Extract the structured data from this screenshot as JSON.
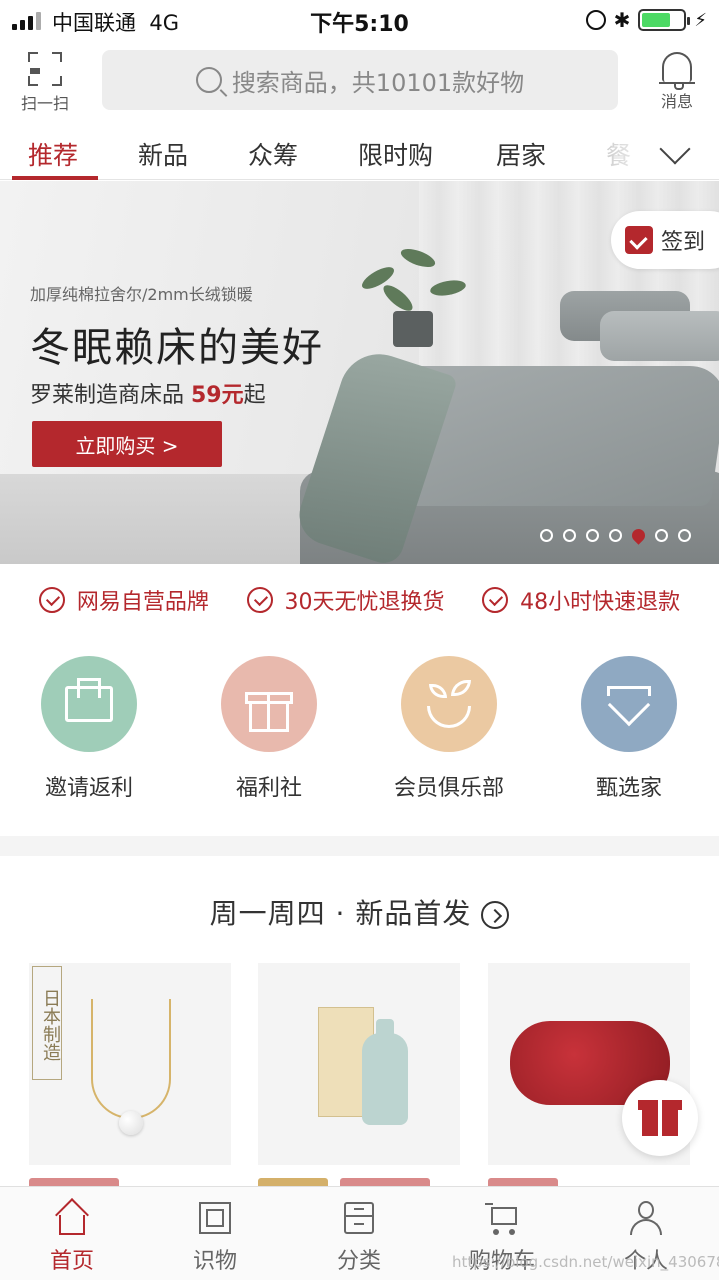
{
  "status_bar": {
    "carrier": "中国联通",
    "network": "4G",
    "time": "下午5:10"
  },
  "header": {
    "scan_label": "扫一扫",
    "search_placeholder": "搜索商品，共10101款好物",
    "message_label": "消息"
  },
  "tabs": [
    {
      "label": "推荐",
      "active": true
    },
    {
      "label": "新品"
    },
    {
      "label": "众筹"
    },
    {
      "label": "限时购"
    },
    {
      "label": "居家"
    },
    {
      "label": "餐"
    }
  ],
  "banner": {
    "subtitle": "加厚纯棉拉舍尔/2mm长绒锁暖",
    "title": "冬眠赖床的美好",
    "line_prefix": "罗莱制造商床品 ",
    "price": "59元",
    "line_suffix": "起",
    "button_label": "立即购买 >",
    "checkin_label": "签到",
    "slide_count": 7,
    "active_slide": 5
  },
  "guarantees": [
    "网易自营品牌",
    "30天无忧退换货",
    "48小时快速退款"
  ],
  "shortcuts": [
    {
      "label": "邀请返利",
      "color": "#9fcdb8",
      "icon": "envelope-icon"
    },
    {
      "label": "福利社",
      "color": "#e8b9ad",
      "icon": "gift-icon"
    },
    {
      "label": "会员俱乐部",
      "color": "#ebc9a2",
      "icon": "sprout-icon"
    },
    {
      "label": "甄选家",
      "color": "#8fa9c2",
      "icon": "diamond-icon"
    }
  ],
  "section": {
    "title": "周一周四 · 新品首发",
    "products": [
      {
        "tag": "日本制造",
        "icon": "pearl-necklace-icon"
      },
      {
        "tag": "",
        "icon": "rice-wine-icon"
      },
      {
        "tag": "",
        "icon": "massage-pillow-icon"
      }
    ]
  },
  "bottom_nav": [
    {
      "label": "首页",
      "active": true
    },
    {
      "label": "识物"
    },
    {
      "label": "分类"
    },
    {
      "label": "购物车"
    },
    {
      "label": "个人"
    }
  ],
  "watermark": "https://blog.csdn.net/weixin_43067873",
  "colors": {
    "brand": "#b4282d",
    "battery": "#4cd964"
  }
}
